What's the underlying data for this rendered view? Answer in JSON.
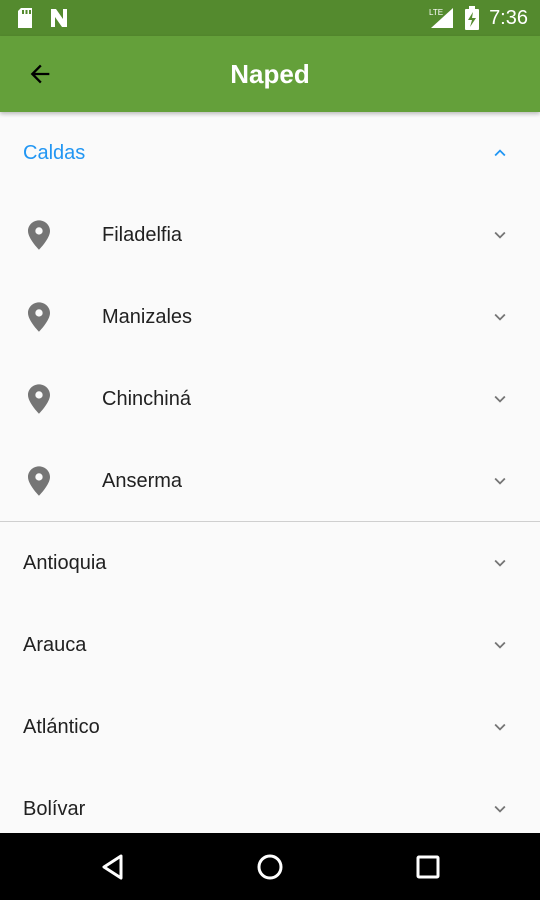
{
  "status_bar": {
    "time": "7:36",
    "icons": [
      "sd-card-icon",
      "n-notification-icon",
      "lte-signal-icon",
      "battery-charging-icon"
    ]
  },
  "app_bar": {
    "title": "Naped",
    "back_icon": "arrow-back-icon",
    "color": "#64a03a"
  },
  "list": {
    "expanded_section": {
      "label": "Caldas",
      "color": "#2196f3",
      "children": [
        {
          "label": "Filadelfia"
        },
        {
          "label": "Manizales"
        },
        {
          "label": "Chinchiná"
        },
        {
          "label": "Anserma"
        }
      ]
    },
    "sections": [
      {
        "label": "Antioquia"
      },
      {
        "label": "Arauca"
      },
      {
        "label": "Atlántico"
      },
      {
        "label": "Bolívar"
      }
    ]
  },
  "nav_bar": {
    "icons": [
      "back-triangle-icon",
      "home-circle-icon",
      "recents-square-icon"
    ]
  }
}
